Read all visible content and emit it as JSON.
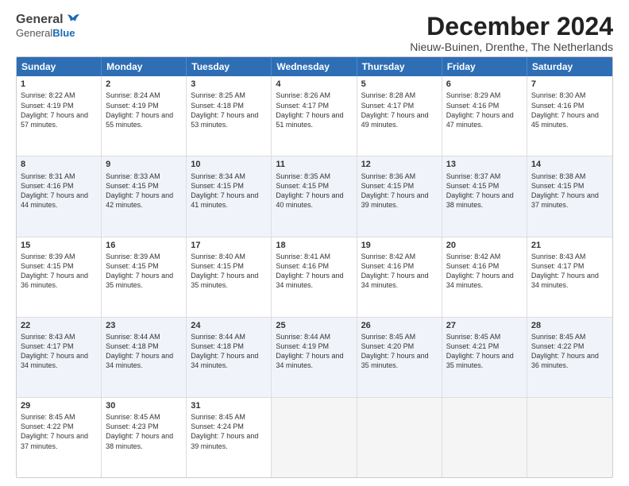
{
  "logo": {
    "general": "General",
    "blue": "Blue"
  },
  "title": "December 2024",
  "location": "Nieuw-Buinen, Drenthe, The Netherlands",
  "days": [
    "Sunday",
    "Monday",
    "Tuesday",
    "Wednesday",
    "Thursday",
    "Friday",
    "Saturday"
  ],
  "rows": [
    [
      {
        "date": "1",
        "sunrise": "Sunrise: 8:22 AM",
        "sunset": "Sunset: 4:19 PM",
        "daylight": "Daylight: 7 hours and 57 minutes."
      },
      {
        "date": "2",
        "sunrise": "Sunrise: 8:24 AM",
        "sunset": "Sunset: 4:19 PM",
        "daylight": "Daylight: 7 hours and 55 minutes."
      },
      {
        "date": "3",
        "sunrise": "Sunrise: 8:25 AM",
        "sunset": "Sunset: 4:18 PM",
        "daylight": "Daylight: 7 hours and 53 minutes."
      },
      {
        "date": "4",
        "sunrise": "Sunrise: 8:26 AM",
        "sunset": "Sunset: 4:17 PM",
        "daylight": "Daylight: 7 hours and 51 minutes."
      },
      {
        "date": "5",
        "sunrise": "Sunrise: 8:28 AM",
        "sunset": "Sunset: 4:17 PM",
        "daylight": "Daylight: 7 hours and 49 minutes."
      },
      {
        "date": "6",
        "sunrise": "Sunrise: 8:29 AM",
        "sunset": "Sunset: 4:16 PM",
        "daylight": "Daylight: 7 hours and 47 minutes."
      },
      {
        "date": "7",
        "sunrise": "Sunrise: 8:30 AM",
        "sunset": "Sunset: 4:16 PM",
        "daylight": "Daylight: 7 hours and 45 minutes."
      }
    ],
    [
      {
        "date": "8",
        "sunrise": "Sunrise: 8:31 AM",
        "sunset": "Sunset: 4:16 PM",
        "daylight": "Daylight: 7 hours and 44 minutes."
      },
      {
        "date": "9",
        "sunrise": "Sunrise: 8:33 AM",
        "sunset": "Sunset: 4:15 PM",
        "daylight": "Daylight: 7 hours and 42 minutes."
      },
      {
        "date": "10",
        "sunrise": "Sunrise: 8:34 AM",
        "sunset": "Sunset: 4:15 PM",
        "daylight": "Daylight: 7 hours and 41 minutes."
      },
      {
        "date": "11",
        "sunrise": "Sunrise: 8:35 AM",
        "sunset": "Sunset: 4:15 PM",
        "daylight": "Daylight: 7 hours and 40 minutes."
      },
      {
        "date": "12",
        "sunrise": "Sunrise: 8:36 AM",
        "sunset": "Sunset: 4:15 PM",
        "daylight": "Daylight: 7 hours and 39 minutes."
      },
      {
        "date": "13",
        "sunrise": "Sunrise: 8:37 AM",
        "sunset": "Sunset: 4:15 PM",
        "daylight": "Daylight: 7 hours and 38 minutes."
      },
      {
        "date": "14",
        "sunrise": "Sunrise: 8:38 AM",
        "sunset": "Sunset: 4:15 PM",
        "daylight": "Daylight: 7 hours and 37 minutes."
      }
    ],
    [
      {
        "date": "15",
        "sunrise": "Sunrise: 8:39 AM",
        "sunset": "Sunset: 4:15 PM",
        "daylight": "Daylight: 7 hours and 36 minutes."
      },
      {
        "date": "16",
        "sunrise": "Sunrise: 8:39 AM",
        "sunset": "Sunset: 4:15 PM",
        "daylight": "Daylight: 7 hours and 35 minutes."
      },
      {
        "date": "17",
        "sunrise": "Sunrise: 8:40 AM",
        "sunset": "Sunset: 4:15 PM",
        "daylight": "Daylight: 7 hours and 35 minutes."
      },
      {
        "date": "18",
        "sunrise": "Sunrise: 8:41 AM",
        "sunset": "Sunset: 4:16 PM",
        "daylight": "Daylight: 7 hours and 34 minutes."
      },
      {
        "date": "19",
        "sunrise": "Sunrise: 8:42 AM",
        "sunset": "Sunset: 4:16 PM",
        "daylight": "Daylight: 7 hours and 34 minutes."
      },
      {
        "date": "20",
        "sunrise": "Sunrise: 8:42 AM",
        "sunset": "Sunset: 4:16 PM",
        "daylight": "Daylight: 7 hours and 34 minutes."
      },
      {
        "date": "21",
        "sunrise": "Sunrise: 8:43 AM",
        "sunset": "Sunset: 4:17 PM",
        "daylight": "Daylight: 7 hours and 34 minutes."
      }
    ],
    [
      {
        "date": "22",
        "sunrise": "Sunrise: 8:43 AM",
        "sunset": "Sunset: 4:17 PM",
        "daylight": "Daylight: 7 hours and 34 minutes."
      },
      {
        "date": "23",
        "sunrise": "Sunrise: 8:44 AM",
        "sunset": "Sunset: 4:18 PM",
        "daylight": "Daylight: 7 hours and 34 minutes."
      },
      {
        "date": "24",
        "sunrise": "Sunrise: 8:44 AM",
        "sunset": "Sunset: 4:18 PM",
        "daylight": "Daylight: 7 hours and 34 minutes."
      },
      {
        "date": "25",
        "sunrise": "Sunrise: 8:44 AM",
        "sunset": "Sunset: 4:19 PM",
        "daylight": "Daylight: 7 hours and 34 minutes."
      },
      {
        "date": "26",
        "sunrise": "Sunrise: 8:45 AM",
        "sunset": "Sunset: 4:20 PM",
        "daylight": "Daylight: 7 hours and 35 minutes."
      },
      {
        "date": "27",
        "sunrise": "Sunrise: 8:45 AM",
        "sunset": "Sunset: 4:21 PM",
        "daylight": "Daylight: 7 hours and 35 minutes."
      },
      {
        "date": "28",
        "sunrise": "Sunrise: 8:45 AM",
        "sunset": "Sunset: 4:22 PM",
        "daylight": "Daylight: 7 hours and 36 minutes."
      }
    ],
    [
      {
        "date": "29",
        "sunrise": "Sunrise: 8:45 AM",
        "sunset": "Sunset: 4:22 PM",
        "daylight": "Daylight: 7 hours and 37 minutes."
      },
      {
        "date": "30",
        "sunrise": "Sunrise: 8:45 AM",
        "sunset": "Sunset: 4:23 PM",
        "daylight": "Daylight: 7 hours and 38 minutes."
      },
      {
        "date": "31",
        "sunrise": "Sunrise: 8:45 AM",
        "sunset": "Sunset: 4:24 PM",
        "daylight": "Daylight: 7 hours and 39 minutes."
      },
      null,
      null,
      null,
      null
    ]
  ]
}
